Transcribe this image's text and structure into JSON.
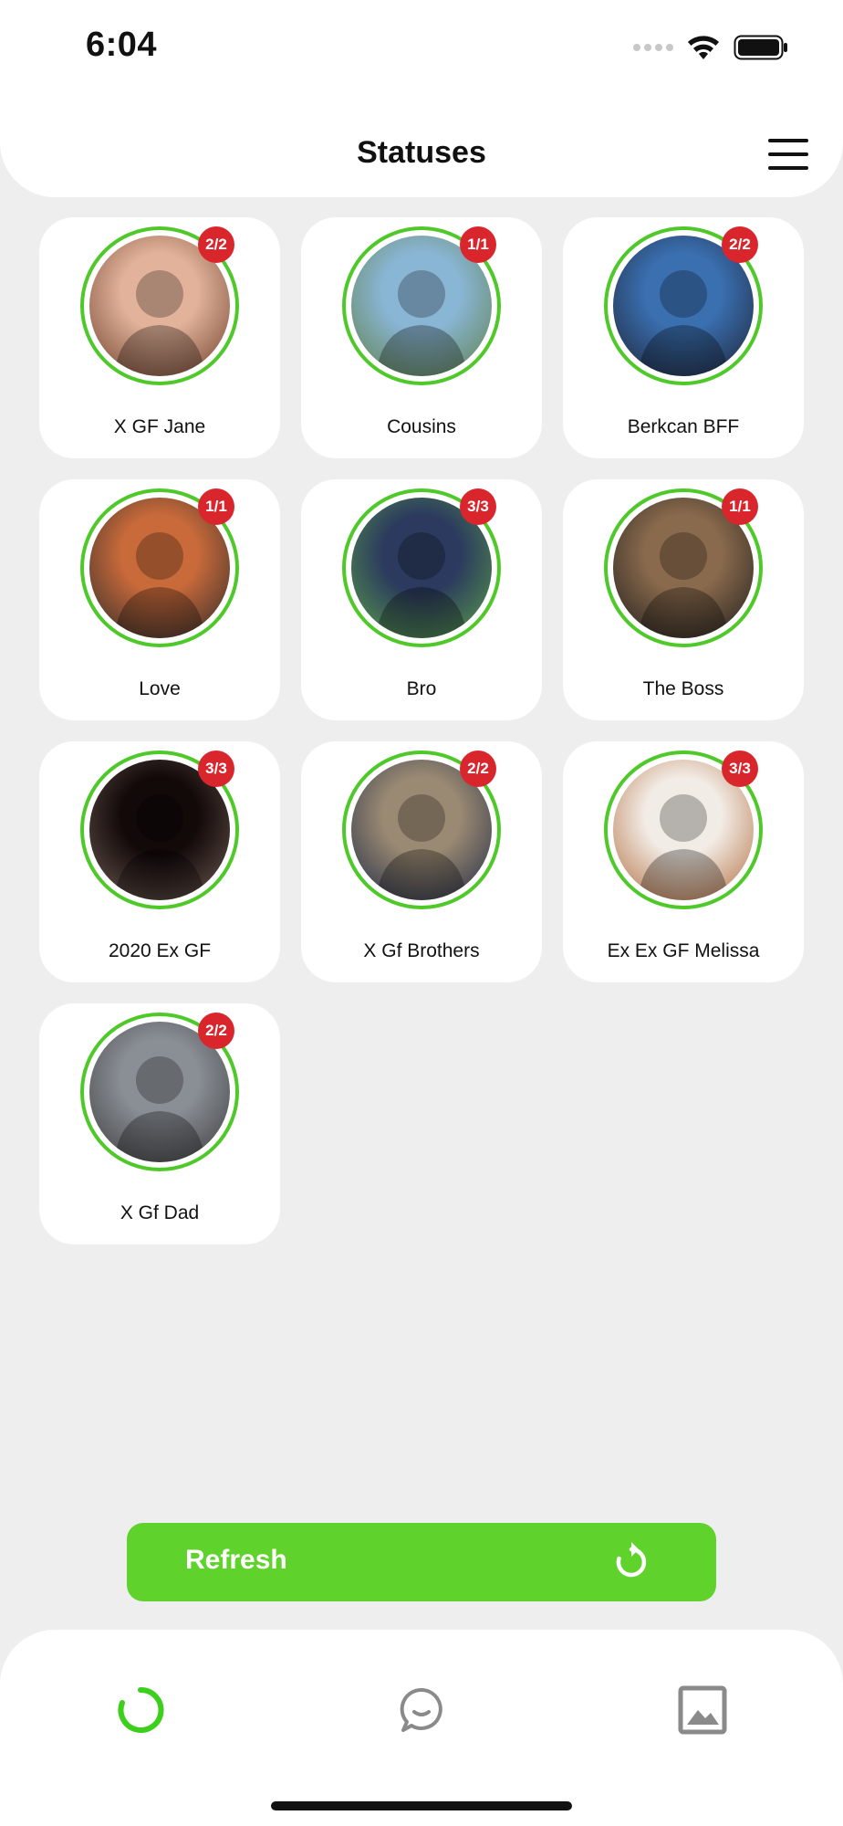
{
  "status_bar": {
    "time": "6:04"
  },
  "header": {
    "title": "Statuses",
    "menu_icon": "hamburger-menu-icon"
  },
  "colors": {
    "accent": "#5fd32c",
    "ring": "#4fc92a",
    "badge": "#d9262c",
    "background": "#eeeeee"
  },
  "statuses": [
    {
      "name": "X GF Jane",
      "badge": "2/2",
      "avatar_palette": [
        "#e2b39a",
        "#6b3d2a"
      ]
    },
    {
      "name": "Cousins",
      "badge": "1/1",
      "avatar_palette": [
        "#8ab6d6",
        "#5e7f47"
      ]
    },
    {
      "name": "Berkcan BFF",
      "badge": "2/2",
      "avatar_palette": [
        "#3a6fb0",
        "#1d2233"
      ]
    },
    {
      "name": "Love",
      "badge": "1/1",
      "avatar_palette": [
        "#c96a3a",
        "#2a2a2a"
      ]
    },
    {
      "name": "Bro",
      "badge": "3/3",
      "avatar_palette": [
        "#2b3a5e",
        "#5a9f4a"
      ]
    },
    {
      "name": "The Boss",
      "badge": "1/1",
      "avatar_palette": [
        "#8a6a4c",
        "#1c1c1c"
      ]
    },
    {
      "name": "2020  Ex GF",
      "badge": "3/3",
      "avatar_palette": [
        "#120909",
        "#6d5a52"
      ]
    },
    {
      "name": "X Gf Brothers",
      "badge": "2/2",
      "avatar_palette": [
        "#9b8a73",
        "#1f2a44"
      ]
    },
    {
      "name": "Ex Ex GF Melissa",
      "badge": "3/3",
      "avatar_palette": [
        "#f2ece6",
        "#b06a3a"
      ]
    },
    {
      "name": "X Gf Dad",
      "badge": "2/2",
      "avatar_palette": [
        "#8a8f96",
        "#3b3b3b"
      ]
    }
  ],
  "refresh": {
    "label": "Refresh",
    "icon": "refresh-icon"
  },
  "bottom_nav": [
    {
      "icon": "statuses-spinner-icon",
      "active": true
    },
    {
      "icon": "chat-bubble-icon",
      "active": false
    },
    {
      "icon": "gallery-image-icon",
      "active": false
    }
  ]
}
